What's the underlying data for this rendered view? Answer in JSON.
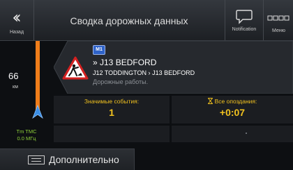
{
  "header": {
    "back_label": "Назад",
    "title": "Сводка дорожных данных",
    "notification_label": "Notification",
    "menu_label": "Меню"
  },
  "route": {
    "distance_value": "66",
    "distance_unit": "км",
    "tmc_line1": "Tm TMC",
    "tmc_line2": "0.0 МГц"
  },
  "event": {
    "road_badge": "M1",
    "title": "» J13 BEDFORD",
    "route_from": "J12 TODDINGTON",
    "route_to": "J13 BEDFORD",
    "route_separator": "›",
    "type": "Дорожные работы."
  },
  "stats": {
    "events_label": "Значимые события:",
    "events_value": "1",
    "delays_label": "Все опоздания:",
    "delays_value": "+0:07"
  },
  "bottom": {
    "more_label": "Дополнительно"
  },
  "icons": {
    "back": "double-chevron-left-icon",
    "notification": "speech-bubble-icon",
    "menu": "grid-icon",
    "warning": "road-works-warning-icon",
    "position": "navigation-arrow-icon",
    "hourglass": "hourglass-icon",
    "more": "list-icon"
  },
  "colors": {
    "route_line": "#f07d1a",
    "accent_yellow": "#f2c21f",
    "tmc_green": "#8fd13a",
    "position_arrow": "#3a8ee6",
    "warning_red": "#d32020",
    "road_badge": "#2f63c9"
  }
}
